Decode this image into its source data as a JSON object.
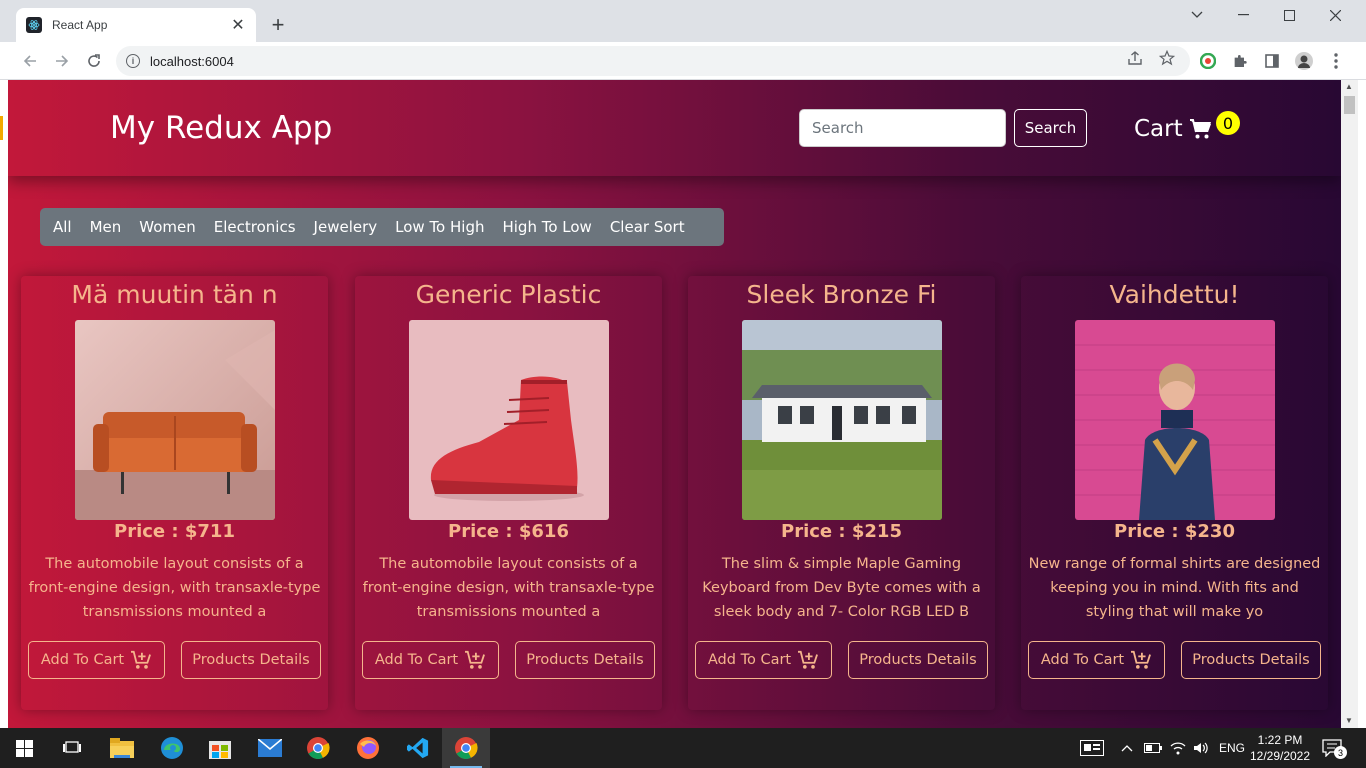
{
  "browser": {
    "tab_title": "React App",
    "tab_close": "✕",
    "new_tab": "+",
    "url": "localhost:6004"
  },
  "header": {
    "brand": "My Redux App",
    "search_placeholder": "Search",
    "search_button": "Search",
    "cart_label": "Cart",
    "cart_count": "0"
  },
  "filters": [
    "All",
    "Men",
    "Women",
    "Electronics",
    "Jewelery",
    "Low To High",
    "High To Low",
    "Clear Sort"
  ],
  "products": [
    {
      "title": "Mä muutin tän n",
      "price": "Price : $711",
      "description": "The automobile layout consists of a front-engine design, with transaxle-type transmissions mounted a",
      "add_to_cart": "Add To Cart",
      "details": "Products Details",
      "image": "orange-sofa"
    },
    {
      "title": "Generic Plastic",
      "price": "Price : $616",
      "description": "The automobile layout consists of a front-engine design, with transaxle-type transmissions mounted a",
      "add_to_cart": "Add To Cart",
      "details": "Products Details",
      "image": "red-sneaker"
    },
    {
      "title": "Sleek Bronze Fi",
      "price": "Price : $215",
      "description": "The slim & simple Maple Gaming Keyboard from Dev Byte comes with a sleek body and 7- Color RGB LED B",
      "add_to_cart": "Add To Cart",
      "details": "Products Details",
      "image": "white-house"
    },
    {
      "title": "Vaihdettu!",
      "price": "Price : $230",
      "description": "New range of formal shirts are designed keeping you in mind. With fits and styling that will make yo",
      "add_to_cart": "Add To Cart",
      "details": "Products Details",
      "image": "woman-pink-wall"
    }
  ],
  "taskbar": {
    "language": "ENG",
    "time": "1:22 PM",
    "date": "12/29/2022",
    "notifications": "3"
  },
  "colors": {
    "accent": "#f5b58c",
    "gradient_start": "#c2183a",
    "gradient_end": "#280833",
    "badge": "#ffff00",
    "filter_bg": "#6c757d"
  }
}
